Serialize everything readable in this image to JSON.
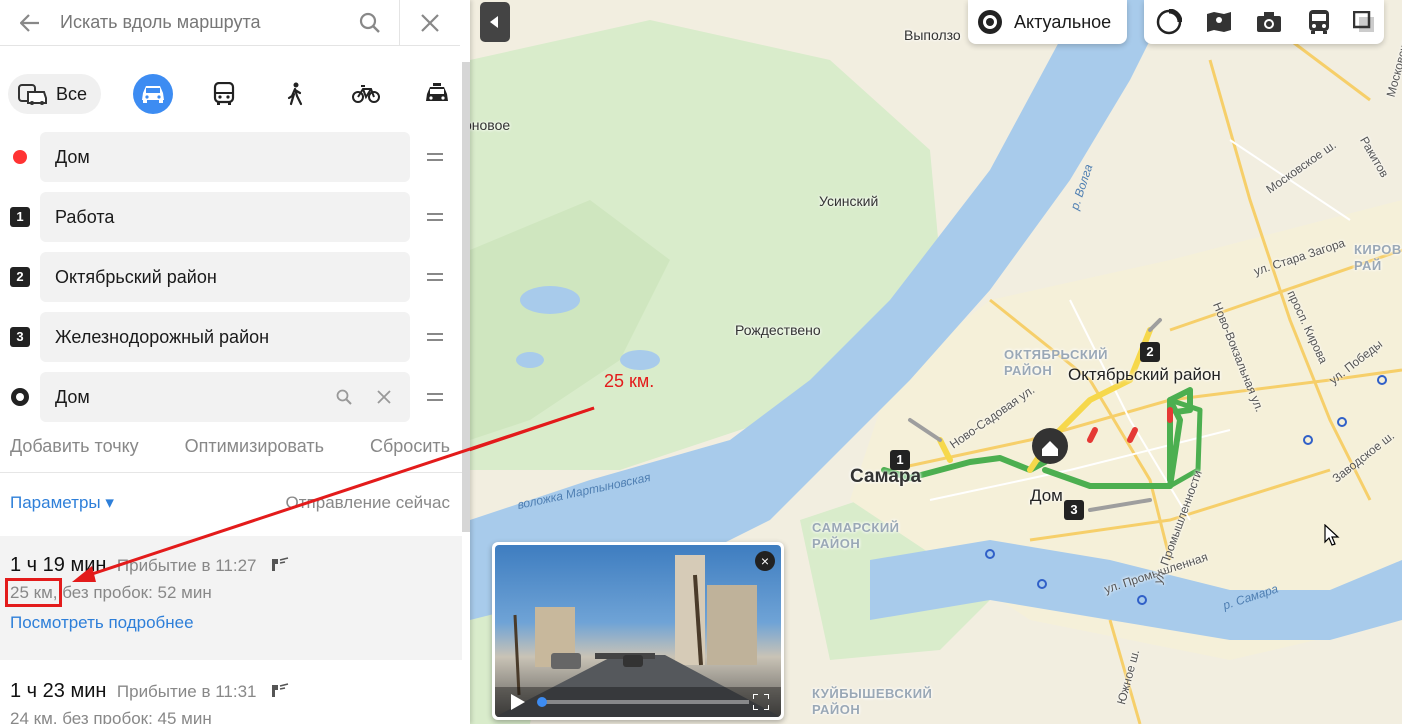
{
  "search": {
    "placeholder": "Искать вдоль маршрута"
  },
  "modes": {
    "all_label": "Все"
  },
  "points": [
    {
      "label": "Дом"
    },
    {
      "num": "1",
      "label": "Работа"
    },
    {
      "num": "2",
      "label": "Октябрьский район"
    },
    {
      "num": "3",
      "label": "Железнодорожный район"
    },
    {
      "label": "Дом"
    }
  ],
  "actions": {
    "add": "Добавить точку",
    "optimize": "Оптимизировать",
    "reset": "Сбросить"
  },
  "params": {
    "label": "Параметры ▾",
    "departure": "Отправление сейчас"
  },
  "routes": [
    {
      "time": "1 ч 19 мин",
      "arrival": "Прибытие в 11:27",
      "distance": "25 км,",
      "no_traffic": " без пробок: 52 мин",
      "more": "Посмотреть подробнее"
    },
    {
      "time": "1 ч 23 мин",
      "arrival": "Прибытие в 11:31",
      "distance": "24 км,",
      "no_traffic": " без пробок: 45 мин"
    }
  ],
  "map": {
    "actual_label": "Актуальное",
    "annotation": "25 км.",
    "labels": {
      "vypolzovo": "Выползо",
      "rnovoe": "рновое",
      "usinsky": "Усинский",
      "rozhdestveno": "Рождествено",
      "oktyabrsky_district": "ОКТЯБРЬСКИЙ\nРАЙОН",
      "oktyabrsky_rayon": "Октябрьский район",
      "samara": "Самара",
      "samarsky": "САМАРСКИЙ\nРАЙОН",
      "kuibyshevsky": "КУЙБЫШЕВСКИЙ\nРАЙОН",
      "kirovsky": "КИРОВ\nРАЙ",
      "dom": "Дом",
      "volga": "р. Волга",
      "samara_river": "р. Самара",
      "voloshka": "воложка Мартыновская",
      "novo_sadovaya": "Ново-Садовая ул.",
      "moskovskoe": "Московское ш.",
      "stara_zagora": "ул. Стара Загора",
      "novo_vokzalnaya": "Ново-Вокзальная ул.",
      "kirova": "просп. Кирова",
      "pobedy": "ул. Победы",
      "zavodskoe": "Заводское ш.",
      "promyshlennaya": "ул. Промышленная",
      "promyshlennosti": "ул. Промышленности",
      "yuzhnoe": "Южное ш.",
      "rakitov": "Ракитов",
      "moskovskoe2": "Московское ш."
    }
  }
}
